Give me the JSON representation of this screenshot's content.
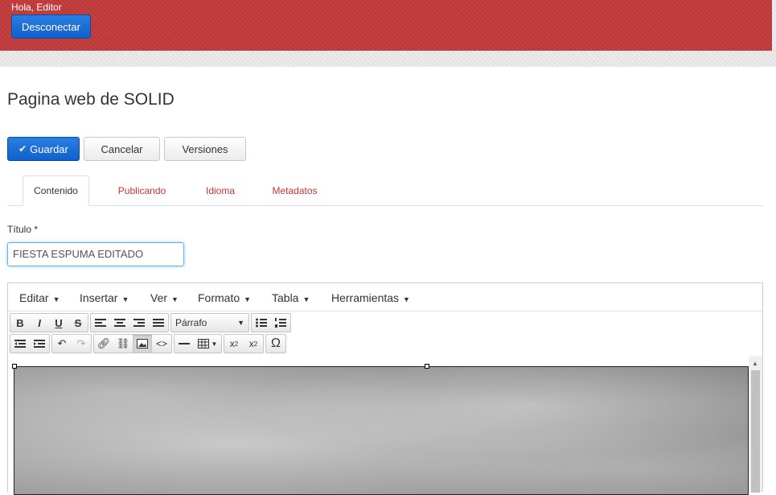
{
  "header": {
    "greeting": "Hola, Editor",
    "logout_label": "Desconectar"
  },
  "page": {
    "title": "Pagina web de SOLID"
  },
  "actions": {
    "save_label": "Guardar",
    "cancel_label": "Cancelar",
    "versions_label": "Versiones"
  },
  "tabs": [
    {
      "label": "Contenido",
      "active": true
    },
    {
      "label": "Publicando",
      "active": false
    },
    {
      "label": "Idioma",
      "active": false
    },
    {
      "label": "Metadatos",
      "active": false
    }
  ],
  "form": {
    "title_label": "Título *",
    "title_value": "FIESTA ESPUMA EDITADO"
  },
  "editor": {
    "menus": [
      "Editar",
      "Insertar",
      "Ver",
      "Formato",
      "Tabla",
      "Herramientas"
    ],
    "format_select": "Párrafo"
  },
  "colors": {
    "header_bg": "#c23b3b",
    "primary_button": "#1a6fd6",
    "tab_link": "#cc3333"
  }
}
